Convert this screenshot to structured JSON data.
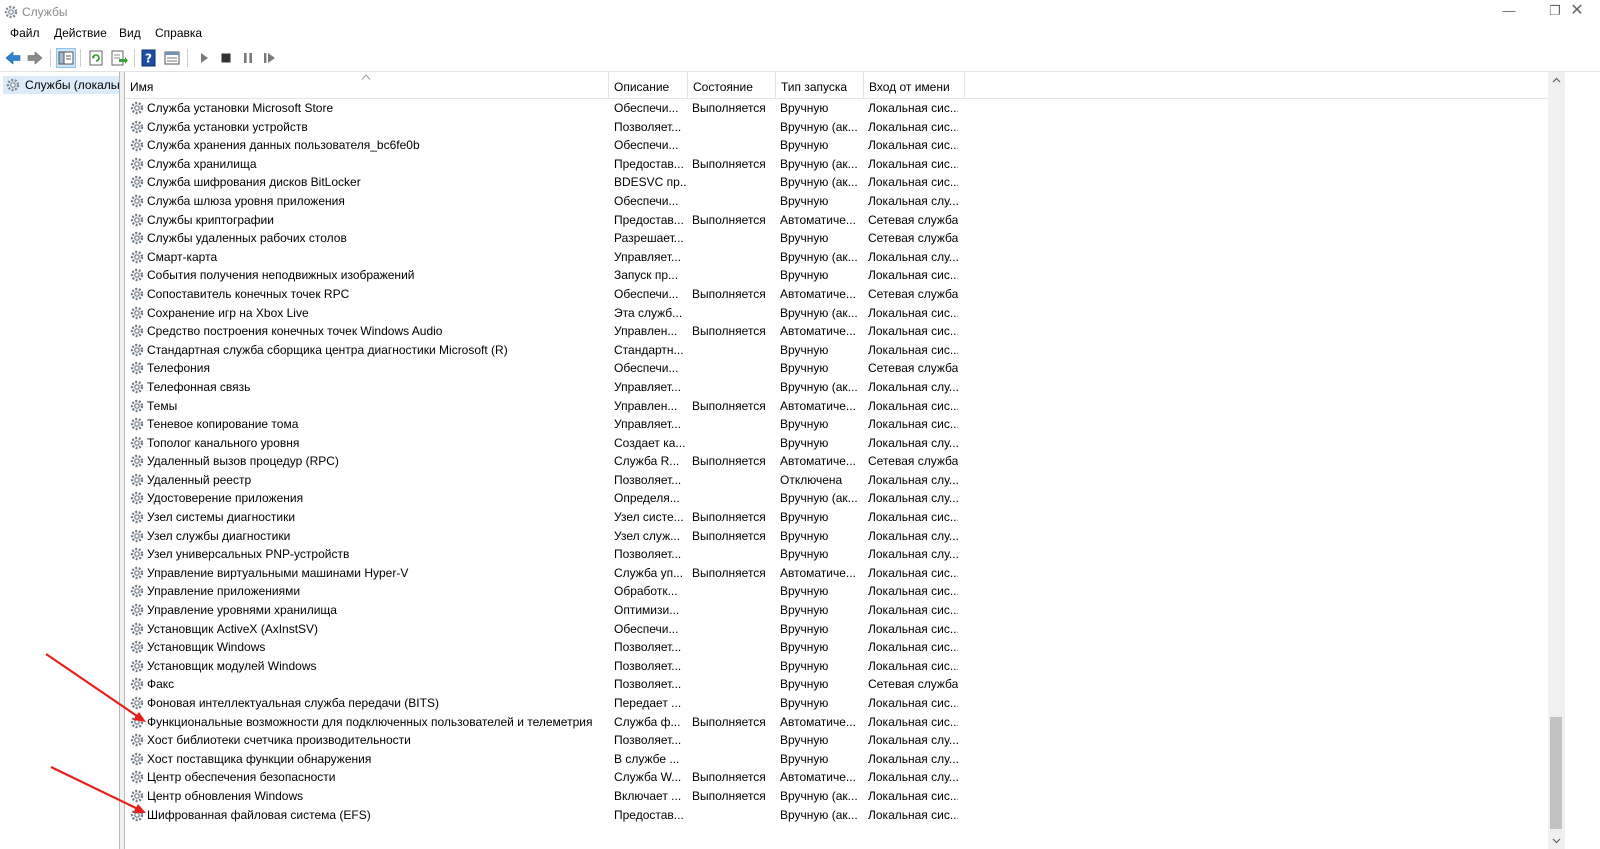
{
  "window": {
    "title": "Службы",
    "minimize": "—",
    "restore": "❐",
    "close": "✕"
  },
  "menu": [
    "Файл",
    "Действие",
    "Вид",
    "Справка"
  ],
  "tree": {
    "item": "Службы (локальные)"
  },
  "columns": [
    "Имя",
    "Описание",
    "Состояние",
    "Тип запуска",
    "Вход от имени"
  ],
  "colors": {
    "selection": "#dcebfa",
    "arrow": "#e8201c",
    "scroll_thumb": "#c2c2c2"
  },
  "rows": [
    {
      "name": "Служба установки Microsoft Store",
      "desc": "Обеспечи...",
      "state": "Выполняется",
      "start": "Вручную",
      "logon": "Локальная сис..."
    },
    {
      "name": "Служба установки устройств",
      "desc": "Позволяет...",
      "state": "",
      "start": "Вручную (ак...",
      "logon": "Локальная сис..."
    },
    {
      "name": "Служба хранения данных пользователя_bc6fe0b",
      "desc": "Обеспечи...",
      "state": "",
      "start": "Вручную",
      "logon": "Локальная сис..."
    },
    {
      "name": "Служба хранилища",
      "desc": "Предостав...",
      "state": "Выполняется",
      "start": "Вручную (ак...",
      "logon": "Локальная сис..."
    },
    {
      "name": "Служба шифрования дисков BitLocker",
      "desc": "BDESVC пр...",
      "state": "",
      "start": "Вручную (ак...",
      "logon": "Локальная сис..."
    },
    {
      "name": "Служба шлюза уровня приложения",
      "desc": "Обеспечи...",
      "state": "",
      "start": "Вручную",
      "logon": "Локальная слу..."
    },
    {
      "name": "Службы криптографии",
      "desc": "Предостав...",
      "state": "Выполняется",
      "start": "Автоматиче...",
      "logon": "Сетевая служба"
    },
    {
      "name": "Службы удаленных рабочих столов",
      "desc": "Разрешает...",
      "state": "",
      "start": "Вручную",
      "logon": "Сетевая служба"
    },
    {
      "name": "Смарт-карта",
      "desc": "Управляет...",
      "state": "",
      "start": "Вручную (ак...",
      "logon": "Локальная слу..."
    },
    {
      "name": "События получения неподвижных изображений",
      "desc": "Запуск пр...",
      "state": "",
      "start": "Вручную",
      "logon": "Локальная сис..."
    },
    {
      "name": "Сопоставитель конечных точек RPC",
      "desc": "Обеспечи...",
      "state": "Выполняется",
      "start": "Автоматиче...",
      "logon": "Сетевая служба"
    },
    {
      "name": "Сохранение игр на Xbox Live",
      "desc": "Эта служб...",
      "state": "",
      "start": "Вручную (ак...",
      "logon": "Локальная сис..."
    },
    {
      "name": "Средство построения конечных точек Windows Audio",
      "desc": "Управлен...",
      "state": "Выполняется",
      "start": "Автоматиче...",
      "logon": "Локальная сис..."
    },
    {
      "name": "Стандартная служба сборщика центра диагностики Microsoft (R)",
      "desc": "Стандартн...",
      "state": "",
      "start": "Вручную",
      "logon": "Локальная сис..."
    },
    {
      "name": "Телефония",
      "desc": "Обеспечи...",
      "state": "",
      "start": "Вручную",
      "logon": "Сетевая служба"
    },
    {
      "name": "Телефонная связь",
      "desc": "Управляет...",
      "state": "",
      "start": "Вручную (ак...",
      "logon": "Локальная слу..."
    },
    {
      "name": "Темы",
      "desc": "Управлен...",
      "state": "Выполняется",
      "start": "Автоматиче...",
      "logon": "Локальная сис..."
    },
    {
      "name": "Теневое копирование тома",
      "desc": "Управляет...",
      "state": "",
      "start": "Вручную",
      "logon": "Локальная сис..."
    },
    {
      "name": "Тополог канального уровня",
      "desc": "Создает ка...",
      "state": "",
      "start": "Вручную",
      "logon": "Локальная слу..."
    },
    {
      "name": "Удаленный вызов процедур (RPC)",
      "desc": "Служба R...",
      "state": "Выполняется",
      "start": "Автоматиче...",
      "logon": "Сетевая служба"
    },
    {
      "name": "Удаленный реестр",
      "desc": "Позволяет...",
      "state": "",
      "start": "Отключена",
      "logon": "Локальная слу..."
    },
    {
      "name": "Удостоверение приложения",
      "desc": "Определя...",
      "state": "",
      "start": "Вручную (ак...",
      "logon": "Локальная слу..."
    },
    {
      "name": "Узел системы диагностики",
      "desc": "Узел систе...",
      "state": "Выполняется",
      "start": "Вручную",
      "logon": "Локальная сис..."
    },
    {
      "name": "Узел службы диагностики",
      "desc": "Узел служ...",
      "state": "Выполняется",
      "start": "Вручную",
      "logon": "Локальная слу..."
    },
    {
      "name": "Узел универсальных PNP-устройств",
      "desc": "Позволяет...",
      "state": "",
      "start": "Вручную",
      "logon": "Локальная слу..."
    },
    {
      "name": "Управление виртуальными машинами Hyper-V",
      "desc": "Служба уп...",
      "state": "Выполняется",
      "start": "Автоматиче...",
      "logon": "Локальная сис..."
    },
    {
      "name": "Управление приложениями",
      "desc": "Обработк...",
      "state": "",
      "start": "Вручную",
      "logon": "Локальная сис..."
    },
    {
      "name": "Управление уровнями хранилища",
      "desc": "Оптимизи...",
      "state": "",
      "start": "Вручную",
      "logon": "Локальная сис..."
    },
    {
      "name": "Установщик ActiveX (AxInstSV)",
      "desc": "Обеспечи...",
      "state": "",
      "start": "Вручную",
      "logon": "Локальная сис..."
    },
    {
      "name": "Установщик Windows",
      "desc": "Позволяет...",
      "state": "",
      "start": "Вручную",
      "logon": "Локальная сис..."
    },
    {
      "name": "Установщик модулей Windows",
      "desc": "Позволяет...",
      "state": "",
      "start": "Вручную",
      "logon": "Локальная сис..."
    },
    {
      "name": "Факс",
      "desc": "Позволяет...",
      "state": "",
      "start": "Вручную",
      "logon": "Сетевая служба"
    },
    {
      "name": "Фоновая интеллектуальная служба передачи (BITS)",
      "desc": "Передает ...",
      "state": "",
      "start": "Вручную",
      "logon": "Локальная сис..."
    },
    {
      "name": "Функциональные возможности для подключенных пользователей и телеметрия",
      "desc": "Служба ф...",
      "state": "Выполняется",
      "start": "Автоматиче...",
      "logon": "Локальная сис..."
    },
    {
      "name": "Хост библиотеки счетчика производительности",
      "desc": "Позволяет...",
      "state": "",
      "start": "Вручную",
      "logon": "Локальная слу..."
    },
    {
      "name": "Хост поставщика функции обнаружения",
      "desc": "В службе ...",
      "state": "",
      "start": "Вручную",
      "logon": "Локальная слу..."
    },
    {
      "name": "Центр обеспечения безопасности",
      "desc": "Служба W...",
      "state": "Выполняется",
      "start": "Автоматиче...",
      "logon": "Локальная слу..."
    },
    {
      "name": "Центр обновления Windows",
      "desc": "Включает ...",
      "state": "Выполняется",
      "start": "Вручную (ак...",
      "logon": "Локальная сис..."
    },
    {
      "name": "Шифрованная файловая система (EFS)",
      "desc": "Предостав...",
      "state": "",
      "start": "Вручную (ак...",
      "logon": "Локальная сис..."
    }
  ]
}
